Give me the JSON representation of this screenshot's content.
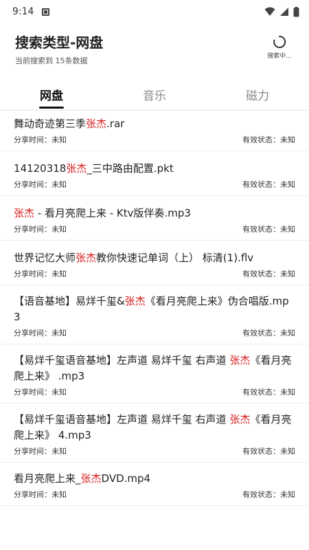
{
  "status_bar": {
    "time": "9:14",
    "icons": [
      "sd-card-icon",
      "wifi-icon",
      "cellular-icon",
      "battery-icon"
    ]
  },
  "header": {
    "title": "搜索类型-网盘",
    "subtitle": "当前搜索到 15条数据",
    "searching_label": "搜索中..."
  },
  "tabs": [
    {
      "label": "网盘",
      "active": true
    },
    {
      "label": "音乐",
      "active": false
    },
    {
      "label": "磁力",
      "active": false
    }
  ],
  "colors": {
    "highlight": "#d81e1e",
    "active_tab": "#111111",
    "inactive_tab": "#888888"
  },
  "items": [
    {
      "title_parts": [
        "舞动奇迹第三季",
        "张杰",
        ".rar"
      ],
      "share_time": "分享时间：未知",
      "status": "有效状态：未知"
    },
    {
      "title_parts": [
        "14120318",
        "张杰",
        "_三中路由配置.pkt"
      ],
      "share_time": "分享时间：未知",
      "status": "有效状态：未知"
    },
    {
      "title_parts": [
        "",
        "张杰",
        " - 看月亮爬上来 - Ktv版伴奏.mp3"
      ],
      "share_time": "分享时间：未知",
      "status": "有效状态：未知"
    },
    {
      "title_parts": [
        "世界记忆大师",
        "张杰",
        "教你快速记单词（上） 标清(1).flv"
      ],
      "share_time": "分享时间：未知",
      "status": "有效状态：未知"
    },
    {
      "title_parts": [
        "【语音基地】易烊千玺&",
        "张杰",
        "《看月亮爬上来》伪合唱版.mp3"
      ],
      "share_time": "分享时间：未知",
      "status": "有效状态：未知"
    },
    {
      "title_parts": [
        "【易烊千玺语音基地】左声道 易烊千玺 右声道 ",
        "张杰",
        "《看月亮爬上来》 .mp3"
      ],
      "share_time": "分享时间：未知",
      "status": "有效状态：未知"
    },
    {
      "title_parts": [
        "【易烊千玺语音基地】左声道 易烊千玺 右声道 ",
        "张杰",
        "《看月亮爬上来》 4.mp3"
      ],
      "share_time": "分享时间：未知",
      "status": "有效状态：未知"
    },
    {
      "title_parts": [
        "看月亮爬上来_",
        "张杰",
        "DVD.mp4"
      ],
      "share_time": "分享时间：未知",
      "status": "有效状态：未知"
    }
  ]
}
